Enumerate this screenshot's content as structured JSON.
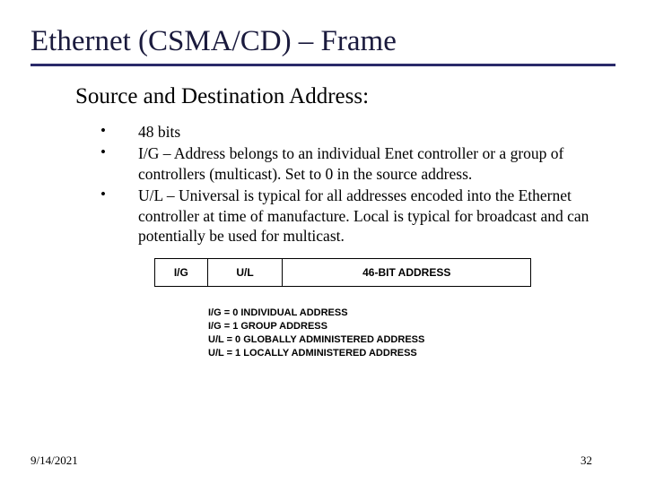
{
  "title": "Ethernet (CSMA/CD) – Frame",
  "subtitle": "Source and Destination Address:",
  "bullets": [
    "48 bits",
    "I/G – Address belongs to an individual Enet controller or a group of controllers (multicast). Set to 0 in the source address.",
    "U/L – Universal is typical for all addresses encoded into the Ethernet controller at time of manufacture. Local is typical for broadcast and can potentially be used for multicast."
  ],
  "diagram": {
    "cells": {
      "ig": "I/G",
      "ul": "U/L",
      "addr": "46-BIT ADDRESS"
    },
    "legend": [
      "I/G = 0 INDIVIDUAL ADDRESS",
      "I/G = 1 GROUP ADDRESS",
      "U/L = 0 GLOBALLY ADMINISTERED ADDRESS",
      "U/L = 1 LOCALLY ADMINISTERED ADDRESS"
    ]
  },
  "footer": {
    "date": "9/14/2021",
    "page": "32"
  }
}
